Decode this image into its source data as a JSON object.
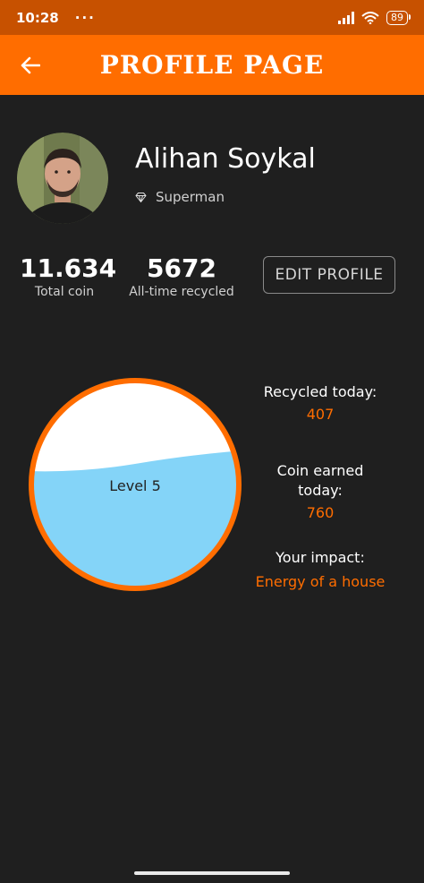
{
  "status_bar": {
    "time": "10:28",
    "dots": "···",
    "battery": "89"
  },
  "app_bar": {
    "title": "PROFILE PAGE",
    "back_icon": "arrow-left-icon"
  },
  "profile": {
    "name": "Alihan Soykal",
    "rank": "Superman",
    "rank_icon": "diamond-icon"
  },
  "stats": [
    {
      "value": "11.634",
      "label": "Total coin"
    },
    {
      "value": "5672",
      "label": "All-time recycled"
    }
  ],
  "edit_button": {
    "label": "EDIT PROFILE"
  },
  "level": {
    "label": "Level 5",
    "fill_fraction": 0.6
  },
  "info": {
    "recycled_today_label": "Recycled today:",
    "recycled_today_value": "407",
    "coin_today_label": "Coin earned today:",
    "coin_today_value": "760",
    "impact_label": "Your impact:",
    "impact_value": "Energy of a house"
  },
  "colors": {
    "accent": "#ff6d00",
    "status_bar": "#c75100",
    "background": "#1f1f1f",
    "water": "#84d4f8"
  }
}
